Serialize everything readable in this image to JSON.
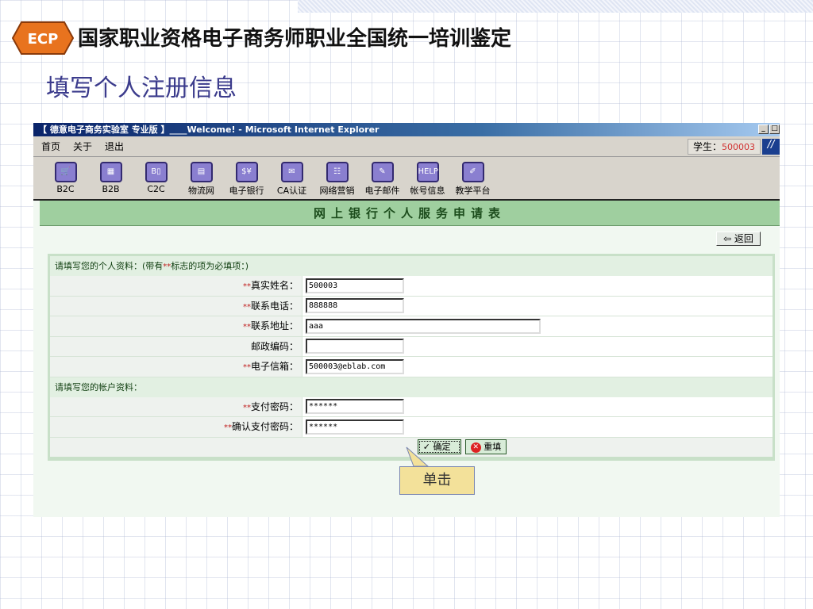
{
  "slide": {
    "brand_text": "国家职业资格电子商务师职业全国统一培训鉴定",
    "logo_text": "ECP",
    "subtitle": "填写个人注册信息",
    "callout": "单击"
  },
  "window": {
    "title": "【 德意电子商务实验室 专业版 】____Welcome! - Microsoft Internet Explorer",
    "menu": [
      "首页",
      "关于",
      "退出"
    ],
    "student_label": "学生：",
    "student_id": "500003",
    "tools": [
      {
        "label": "B2C",
        "icon": "cart-icon",
        "g": "🛒"
      },
      {
        "label": "B2B",
        "icon": "servers-icon",
        "g": "▦"
      },
      {
        "label": "C2C",
        "icon": "folder-icon",
        "g": "B▯"
      },
      {
        "label": "物流网",
        "icon": "truck-icon",
        "g": "▤"
      },
      {
        "label": "电子银行",
        "icon": "money-bag-icon",
        "g": "$¥"
      },
      {
        "label": "CA认证",
        "icon": "certificate-icon",
        "g": "✉"
      },
      {
        "label": "网络营销",
        "icon": "network-icon",
        "g": "☷"
      },
      {
        "label": "电子邮件",
        "icon": "email-icon",
        "g": "✎"
      },
      {
        "label": "帐号信息",
        "icon": "help-book-icon",
        "g": "HELP"
      },
      {
        "label": "教学平台",
        "icon": "pen-icon",
        "g": "✐"
      }
    ]
  },
  "page": {
    "header": "网上银行个人服务申请表",
    "back_label": "返回",
    "personal_section": {
      "prefix": "请填写您的个人资料：(带有",
      "req_mark": "**",
      "suffix": "标志的项为必填项：)"
    },
    "fields": [
      {
        "label": "真实姓名：",
        "required": true,
        "value": "500003"
      },
      {
        "label": "联系电话：",
        "required": true,
        "value": "888888"
      },
      {
        "label": "联系地址：",
        "required": true,
        "value": "aaa"
      },
      {
        "label": "邮政编码：",
        "required": false,
        "value": ""
      },
      {
        "label": "电子信箱：",
        "required": true,
        "value": "500003@eblab.com"
      }
    ],
    "account_section": "请填写您的帐户资料：",
    "account_fields": [
      {
        "label": "支付密码：",
        "required": true,
        "value": "******"
      },
      {
        "label": "确认支付密码：",
        "required": true,
        "value": "******"
      }
    ],
    "submit_label": "确定",
    "reset_label": "重填"
  }
}
